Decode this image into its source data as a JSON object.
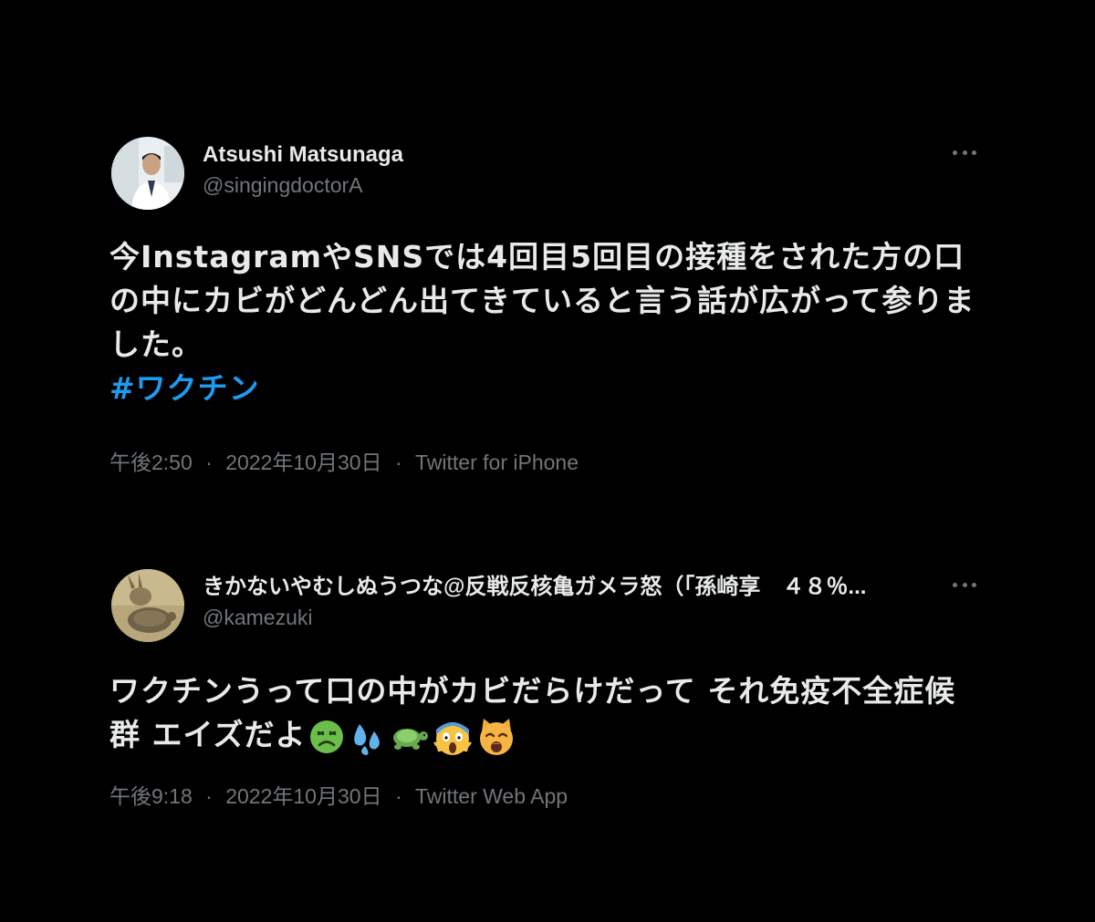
{
  "tweets": [
    {
      "display_name": "Atsushi Matsunaga",
      "handle": "@singingdoctorA",
      "text": "今InstagramやSNSでは4回目5回目の接種をされた方の口の中にカビがどんどん出てきていると言う話が広がって参りました。",
      "hashtag": "#ワクチン",
      "time": "午後2:50",
      "date": "2022年10月30日",
      "separator": "·",
      "source": "Twitter for iPhone"
    },
    {
      "display_name": "きかないやむしぬうつな@反戦反核亀ガメラ怒（「孫崎享　４８％...",
      "handle": "@kamezuki",
      "text": "ワクチンうって口の中がカビだらけだって それ免疫不全症候群 エイズだよ",
      "emojis": [
        "nauseated-face-emoji",
        "sweat-droplets-emoji",
        "turtle-emoji",
        "screaming-face-emoji",
        "weary-cat-emoji"
      ],
      "time": "午後9:18",
      "date": "2022年10月30日",
      "separator": "·",
      "source": "Twitter Web App"
    }
  ],
  "colors": {
    "background": "#000000",
    "text": "#e7e9ea",
    "secondary": "#71767b",
    "link": "#1d9bf0"
  }
}
